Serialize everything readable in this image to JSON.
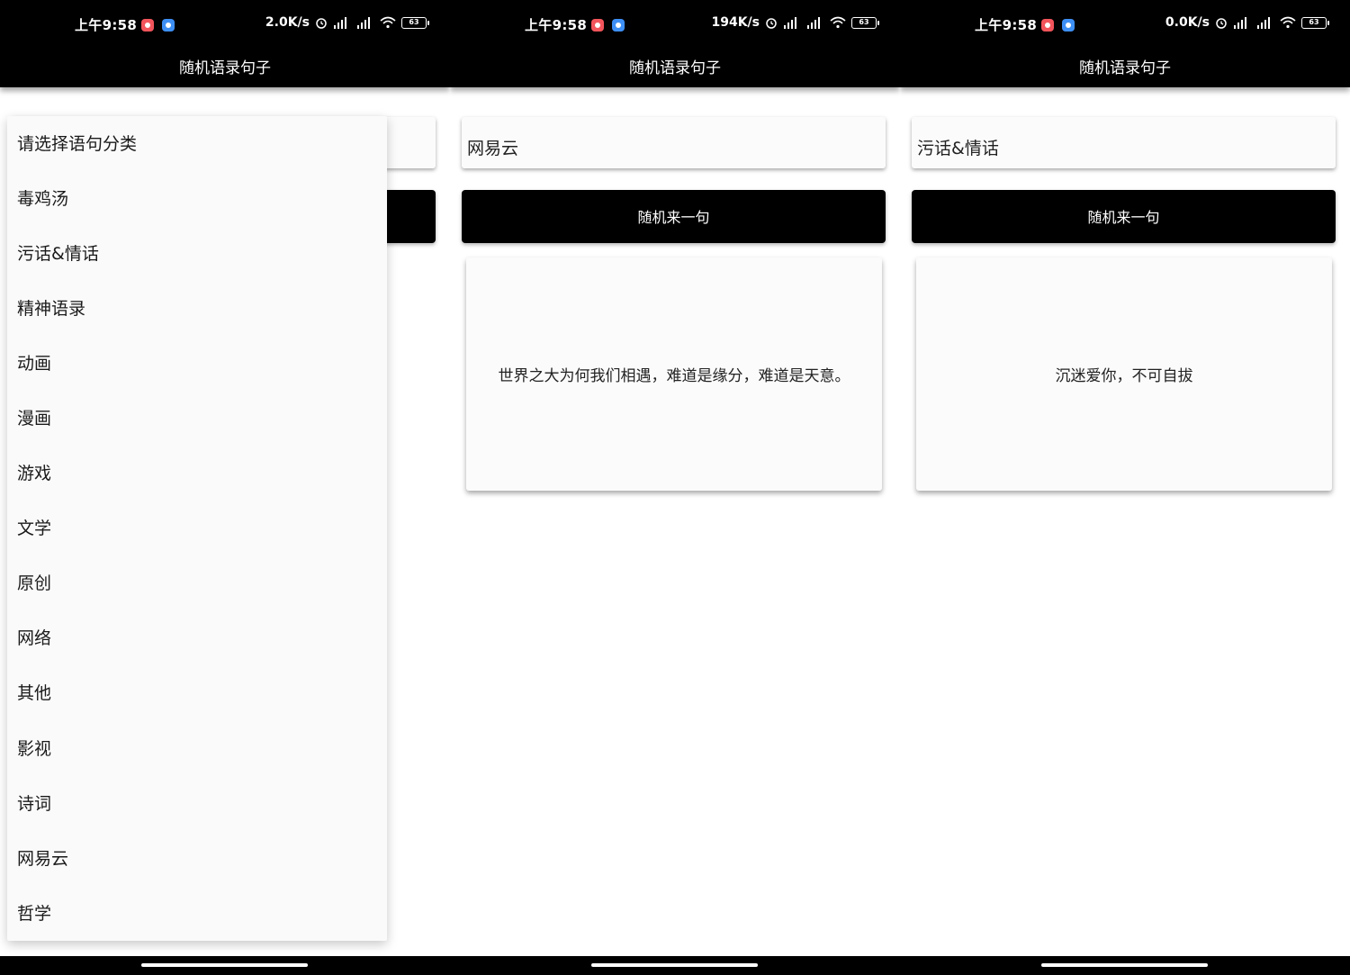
{
  "phones": [
    {
      "status": {
        "time": "上午9:58",
        "speed": "2.0K/s",
        "battery": "63"
      },
      "appbar_title": "随机语录句子",
      "selected_category": "请选择语句分类",
      "button_label": "随机来一句",
      "quote": "",
      "dropdown_open": true
    },
    {
      "status": {
        "time": "上午9:58",
        "speed": "194K/s",
        "battery": "63"
      },
      "appbar_title": "随机语录句子",
      "selected_category": "网易云",
      "button_label": "随机来一句",
      "quote": "世界之大为何我们相遇，难道是缘分，难道是天意。",
      "dropdown_open": false
    },
    {
      "status": {
        "time": "上午9:58",
        "speed": "0.0K/s",
        "battery": "63"
      },
      "appbar_title": "随机语录句子",
      "selected_category": "污话&情话",
      "button_label": "随机来一句",
      "quote": "沉迷爱你，不可自拔",
      "dropdown_open": false
    }
  ],
  "dropdown": {
    "items": [
      "请选择语句分类",
      "毒鸡汤",
      "污话&情话",
      "精神语录",
      "动画",
      "漫画",
      "游戏",
      "文学",
      "原创",
      "网络",
      "其他",
      "影视",
      "诗词",
      "网易云",
      "哲学"
    ]
  },
  "icons": {
    "status": [
      "notification-red-icon",
      "cloud-app-icon",
      "alarm-icon",
      "signal-hd-icon",
      "wifi-icon",
      "battery-icon"
    ]
  },
  "colors": {
    "bar": "#000000",
    "card": "#fbfbfb",
    "app_red": "#f2545b",
    "app_blue": "#3d8ff5"
  }
}
